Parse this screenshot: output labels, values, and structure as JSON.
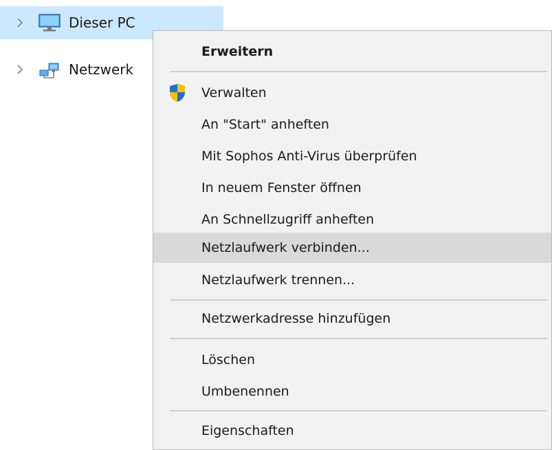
{
  "tree": {
    "items": [
      {
        "label": "Dieser PC",
        "icon": "monitor-icon",
        "selected": true
      },
      {
        "label": "Netzwerk",
        "icon": "network-icon",
        "selected": false
      }
    ]
  },
  "context_menu": {
    "items": [
      {
        "label": "Erweitern",
        "bold": true
      },
      {
        "label": "Verwalten",
        "icon": "uac-shield-icon"
      },
      {
        "label": "An \"Start\" anheften"
      },
      {
        "label": "Mit Sophos Anti-Virus überprüfen"
      },
      {
        "label": "In neuem Fenster öffnen"
      },
      {
        "label": "An Schnellzugriff anheften"
      },
      {
        "label": "Netzlaufwerk verbinden...",
        "highlighted": true
      },
      {
        "label": "Netzlaufwerk trennen..."
      },
      {
        "label": "Netzwerkadresse hinzufügen"
      },
      {
        "label": "Löschen"
      },
      {
        "label": "Umbenennen"
      },
      {
        "label": "Eigenschaften"
      }
    ]
  },
  "colors": {
    "selection": "#cce8ff",
    "menu_background": "#f2f2f2",
    "menu_highlight": "#d9d9d9",
    "shield_blue": "#1f6fd1",
    "shield_yellow": "#f2c200"
  }
}
